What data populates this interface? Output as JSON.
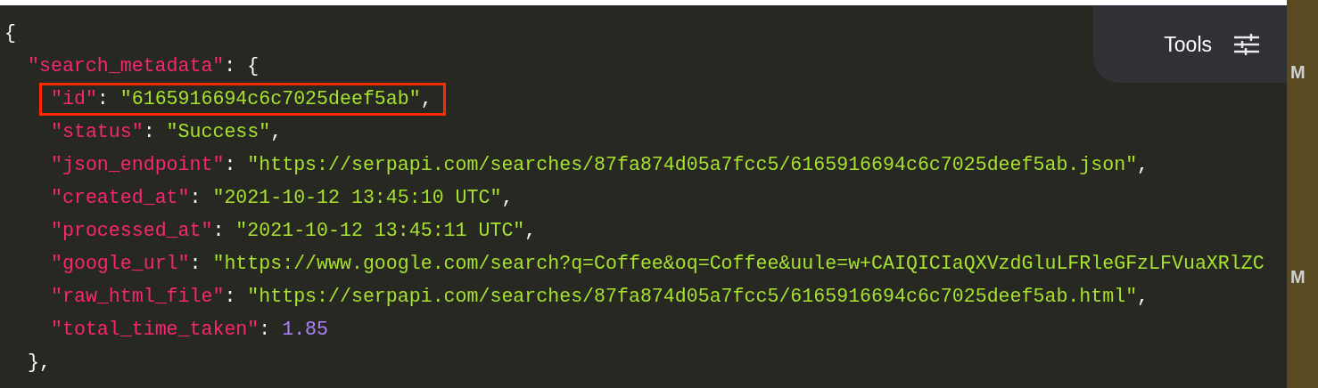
{
  "code": {
    "open": "{",
    "children": [
      {
        "key": "\"search_metadata\"",
        "sep": ": ",
        "open": "{",
        "close": "},",
        "children": [
          {
            "key": "\"id\"",
            "sep": ": ",
            "value": "\"6165916694c6c7025deef5ab\"",
            "kind": "string",
            "trail": ",",
            "highlighted": true
          },
          {
            "key": "\"status\"",
            "sep": ": ",
            "value": "\"Success\"",
            "kind": "string",
            "trail": ",",
            "highlighted": false
          },
          {
            "key": "\"json_endpoint\"",
            "sep": ": ",
            "value": "\"https://serpapi.com/searches/87fa874d05a7fcc5/6165916694c6c7025deef5ab.json\"",
            "kind": "string",
            "trail": ",",
            "highlighted": false
          },
          {
            "key": "\"created_at\"",
            "sep": ": ",
            "value": "\"2021-10-12 13:45:10 UTC\"",
            "kind": "string",
            "trail": ",",
            "highlighted": false
          },
          {
            "key": "\"processed_at\"",
            "sep": ": ",
            "value": "\"2021-10-12 13:45:11 UTC\"",
            "kind": "string",
            "trail": ",",
            "highlighted": false
          },
          {
            "key": "\"google_url\"",
            "sep": ": ",
            "value": "\"https://www.google.com/search?q=Coffee&oq=Coffee&uule=w+CAIQICIaQXVzdGluLFRleGFzLFVuaXRlZC",
            "kind": "string",
            "highlighted": false
          },
          {
            "key": "\"raw_html_file\"",
            "sep": ": ",
            "value": "\"https://serpapi.com/searches/87fa874d05a7fcc5/6165916694c6c7025deef5ab.html\"",
            "kind": "string",
            "trail": ",",
            "highlighted": false
          },
          {
            "key": "\"total_time_taken\"",
            "sep": ": ",
            "value": "1.85",
            "kind": "number",
            "highlighted": false
          }
        ]
      }
    ]
  },
  "tools_panel": {
    "label": "Tools"
  },
  "desktop_labels": [
    "M",
    "M"
  ]
}
